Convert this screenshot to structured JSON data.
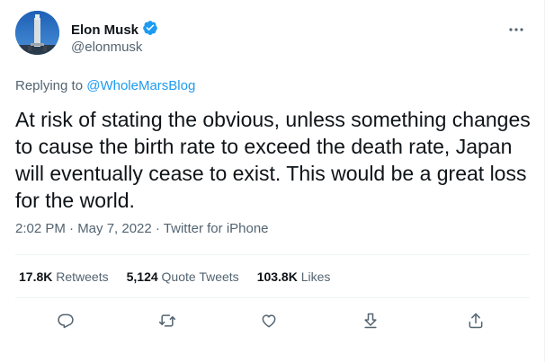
{
  "author": {
    "name": "Elon Musk",
    "handle": "@elonmusk",
    "verified": true,
    "verified_color": "#1d9bf0"
  },
  "reply": {
    "prefix": "Replying to ",
    "target": "@WholeMarsBlog"
  },
  "tweet": {
    "text": "At risk of stating the obvious, unless something changes to cause the birth rate to exceed the death rate, Japan will eventually cease to exist. This would be a great loss for the world.",
    "meta": "2:02 PM · May 7, 2022 · Twitter for iPhone"
  },
  "stats": {
    "retweets_count": "17.8K",
    "retweets_label": "Retweets",
    "quotes_count": "5,124",
    "quotes_label": "Quote Tweets",
    "likes_count": "103.8K",
    "likes_label": "Likes"
  },
  "actions": {
    "icons": [
      "reply-icon",
      "retweet-icon",
      "like-icon",
      "share-icon",
      "export-icon"
    ]
  },
  "colors": {
    "text": "#0f1419",
    "secondary": "#536471",
    "accent": "#1d9bf0",
    "divider": "#eff3f4"
  }
}
